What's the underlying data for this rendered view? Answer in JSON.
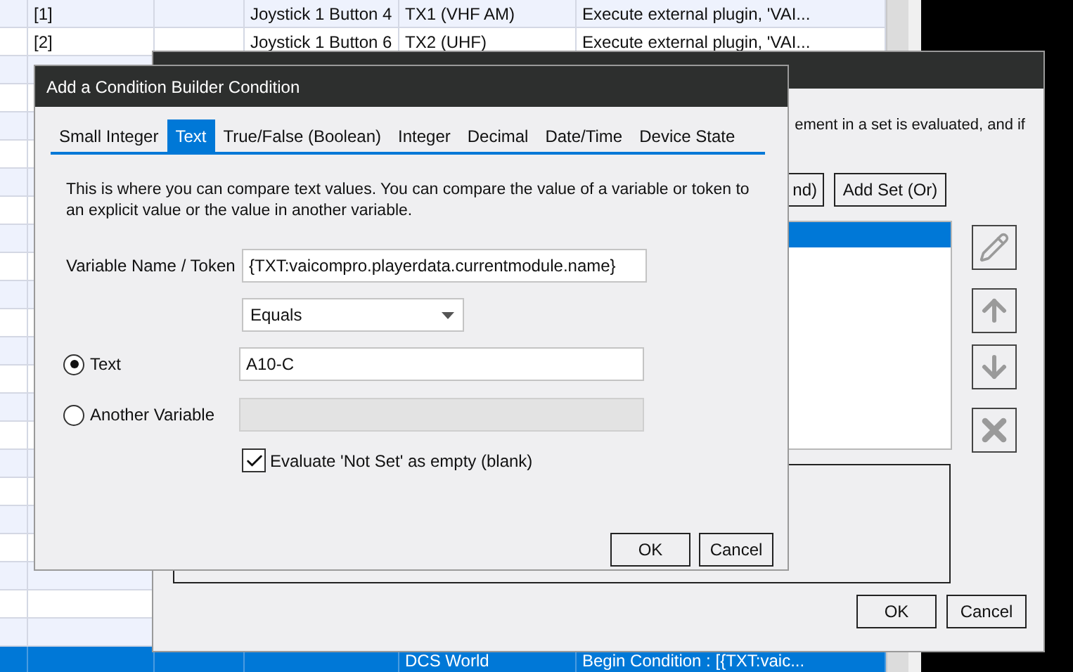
{
  "background_table": {
    "rows": [
      {
        "cells": [
          "",
          "[1]",
          "",
          "Joystick 1 Button 4",
          "TX1 (VHF AM)",
          "Execute external plugin, 'VAI..."
        ],
        "selected": false
      },
      {
        "cells": [
          "",
          "[2]",
          "",
          "Joystick 1 Button 6",
          "TX2 (UHF)",
          "Execute external plugin, 'VAI..."
        ],
        "selected": false
      },
      {
        "cells": [
          "",
          "",
          "",
          "",
          "DCS World",
          "Begin Condition : [{TXT:vaic..."
        ],
        "selected": true
      }
    ]
  },
  "builder_dialog": {
    "description_fragment": "ement in a set is evaluated, and if",
    "set_buttons": [
      "nd)",
      "Add Set (Or)"
    ],
    "condition_list": [
      {
        "selected": true
      }
    ],
    "buttons": [
      "OK",
      "Cancel"
    ]
  },
  "condition_dialog": {
    "title": "Add a Condition Builder Condition",
    "tabs": [
      {
        "label": "Small Integer",
        "selected": false
      },
      {
        "label": "Text",
        "selected": true
      },
      {
        "label": "True/False (Boolean)",
        "selected": false
      },
      {
        "label": "Integer",
        "selected": false
      },
      {
        "label": "Decimal",
        "selected": false
      },
      {
        "label": "Date/Time",
        "selected": false
      },
      {
        "label": "Device State",
        "selected": false
      }
    ],
    "description": "This is where you can compare text values.  You can compare the value of a variable or token to an explicit value or the value in another variable.",
    "variable_field": {
      "label": "Variable Name / Token",
      "value": "{TXT:vaicompro.playerdata.currentmodule.name}"
    },
    "operator_dropdown": {
      "value": "Equals"
    },
    "compare_options": [
      {
        "label": "Text",
        "selected": true,
        "value": "A10-C"
      },
      {
        "label": "Another Variable",
        "selected": false
      }
    ],
    "not_set_checkbox": {
      "label": "Evaluate 'Not Set' as empty (blank)",
      "checked": true
    },
    "buttons": [
      "OK",
      "Cancel"
    ]
  }
}
